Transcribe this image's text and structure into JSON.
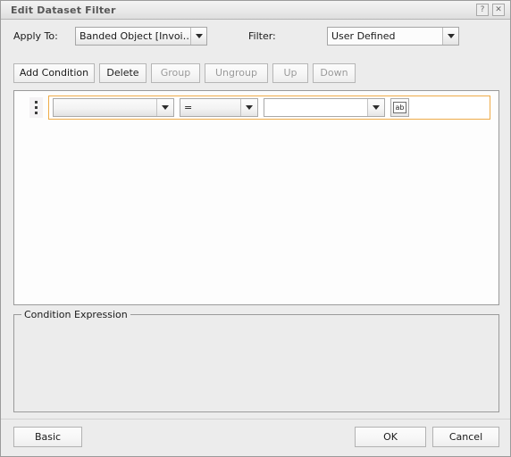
{
  "window": {
    "title": "Edit Dataset Filter",
    "help_label": "?",
    "close_label": "✕"
  },
  "form": {
    "apply_to_label": "Apply To:",
    "apply_to_value": "Banded Object [Invoi…",
    "filter_label": "Filter:",
    "filter_value": "User Defined"
  },
  "toolbar": {
    "add_condition_label": "Add Condition",
    "delete_label": "Delete",
    "group_label": "Group",
    "ungroup_label": "Ungroup",
    "up_label": "Up",
    "down_label": "Down"
  },
  "conditions": {
    "rows": [
      {
        "field_value": "",
        "operator_value": "=",
        "value_value": "",
        "ab_label": "ab"
      }
    ]
  },
  "expression": {
    "legend": "Condition Expression",
    "text": ""
  },
  "footer": {
    "basic_label": "Basic",
    "ok_label": "OK",
    "cancel_label": "Cancel"
  },
  "colors": {
    "highlight_border": "#efab48",
    "dialog_bg": "#ececec",
    "panel_bg": "#fdfdfd",
    "disabled_text": "#9a9a9a"
  }
}
